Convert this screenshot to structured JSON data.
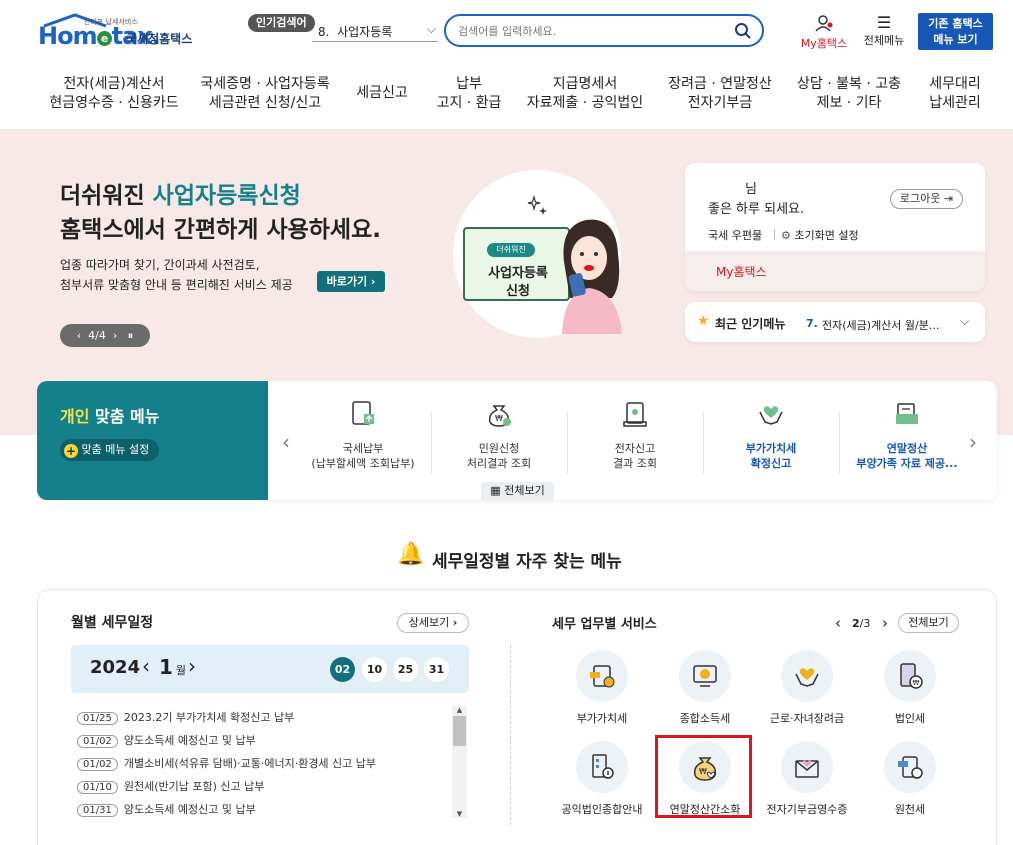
{
  "header": {
    "logo_small": "안티포 납세서비스",
    "logo_home": "Hom",
    "logo_e": "e",
    "logo_tax": "tax.",
    "logo_name": "국세청홈택스",
    "popular_badge": "인기검색어",
    "popular_selected": "8.  사업자등록",
    "search_placeholder": "검색어를 입력하세요.",
    "myhometax": "My홈택스",
    "allmenu": "전체메뉴",
    "old_hometax_1": "기존 홈택스",
    "old_hometax_2": "메뉴 보기"
  },
  "nav": [
    {
      "l1": "전자(세금)계산서",
      "l2": "현금영수증 · 신용카드"
    },
    {
      "l1": "국세증명 · 사업자등록",
      "l2": "세금관련 신청/신고"
    },
    {
      "l1": "세금신고",
      "l2": ""
    },
    {
      "l1": "납부",
      "l2": "고지 · 환급"
    },
    {
      "l1": "지급명세서",
      "l2": "자료제출 · 공익법인"
    },
    {
      "l1": "장려금 · 연말정산",
      "l2": "전자기부금"
    },
    {
      "l1": "상담 · 불복 · 고충",
      "l2": "제보 · 기타"
    },
    {
      "l1": "세무대리",
      "l2": "납세관리"
    }
  ],
  "banner": {
    "line1a": "더쉬워진 ",
    "line1b": "사업자등록신청",
    "line2": "홈택스에서 간편하게 사용하세요.",
    "desc1": "업종 따라가며 찾기, 간이과세 사전검토,",
    "desc2": "첨부서류 맞춤형 안내 등 편리해진 서비스 제공",
    "cta": "바로가기 ›",
    "pager": "‹  4/4  ›   ⏸",
    "ill_badge": "더쉬워진",
    "ill_title1": "사업자등록",
    "ill_title2": "신청"
  },
  "user": {
    "name_suffix": "님",
    "greeting": "좋은 하루 되세요.",
    "logout": "로그아웃",
    "mailbox": "국세 우편물",
    "init_setting": "초기화면 설정",
    "my": "My홈택스"
  },
  "recent": {
    "label": "최근 인기메뉴",
    "num": "7.",
    "item": "전자(세금)계산서 월/분..."
  },
  "personal": {
    "title_a": "개인",
    "title_b": " 맞춤 메뉴",
    "setting": "맞춤 메뉴 설정",
    "items": [
      {
        "l1": "국세납부",
        "l2": "(납부할세액 조회납부)"
      },
      {
        "l1": "민원신청",
        "l2": "처리결과 조회"
      },
      {
        "l1": "전자신고",
        "l2": "결과 조회"
      },
      {
        "l1": "부가가치세",
        "l2": "확정신고"
      },
      {
        "l1": "연말정산",
        "l2": "부양가족 자료 제공..."
      }
    ],
    "view_all": "전체보기"
  },
  "section_title": "세무일정별 자주 찾는 메뉴",
  "schedule": {
    "title": "월별 세무일정",
    "detail": "상세보기",
    "year": "2024",
    "month": "1",
    "month_unit": "월",
    "days": [
      "02",
      "10",
      "25",
      "31"
    ],
    "items": [
      {
        "date": "01/25",
        "text": "2023.2기 부가가치세 확정신고 납부"
      },
      {
        "date": "01/02",
        "text": "양도소득세 예정신고 및 납부"
      },
      {
        "date": "01/02",
        "text": "개별소비세(석유류 담배)·교통·에너지·환경세 신고 납부"
      },
      {
        "date": "01/10",
        "text": "원천세(반기납 포함) 신고 납부"
      },
      {
        "date": "01/31",
        "text": "양도소득세 예정신고 및 납부"
      }
    ]
  },
  "services": {
    "title": "세무 업무별 서비스",
    "page_current": "2",
    "page_total": "/3",
    "view_all": "전체보기",
    "items": [
      {
        "label": "부가가치세",
        "icon": "vat-icon"
      },
      {
        "label": "종합소득세",
        "icon": "income-tax-icon"
      },
      {
        "label": "근로·자녀장려금",
        "icon": "hands-heart-icon"
      },
      {
        "label": "법인세",
        "icon": "corporate-tax-icon"
      },
      {
        "label": "공익법인종합안내",
        "icon": "public-corp-icon"
      },
      {
        "label": "연말정산간소화",
        "icon": "money-bag-icon"
      },
      {
        "label": "전자기부금영수증",
        "icon": "donation-mail-icon"
      },
      {
        "label": "원천세",
        "icon": "withholding-tax-icon"
      }
    ]
  },
  "colors": {
    "brand_blue": "#1b63c6",
    "teal": "#13808a",
    "highlight_red": "#e0141e"
  }
}
